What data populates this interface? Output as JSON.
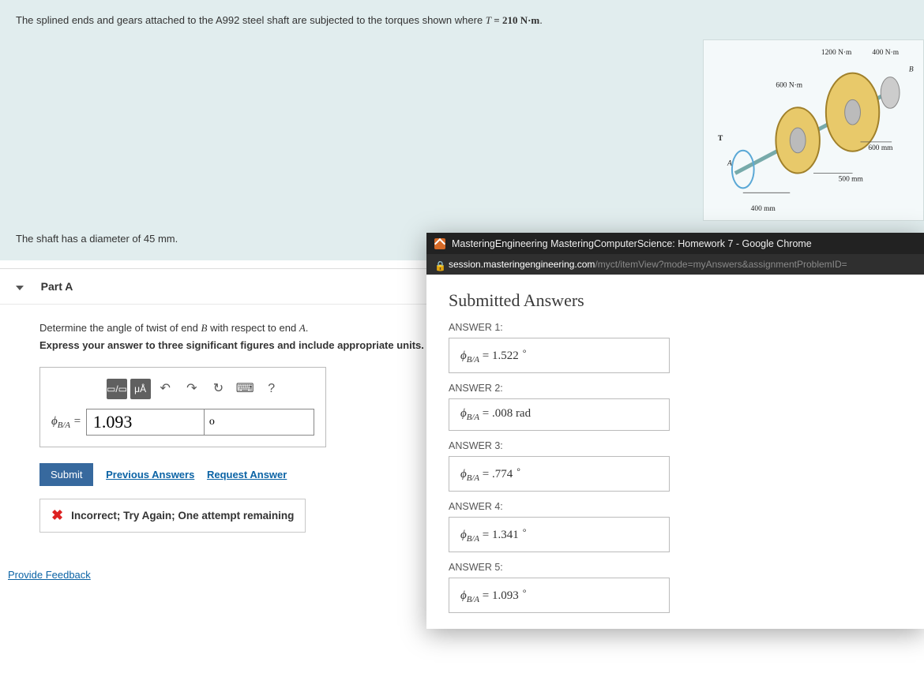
{
  "problem": {
    "intro_prefix": "The splined ends and gears attached to the A992 steel shaft are subjected to the torques shown where ",
    "torque_var": "T",
    "torque_eq": " = 210 N·m",
    "intro_suffix": ".",
    "diameter_line_prefix": "The shaft has a diameter of ",
    "diameter_value": "45 mm",
    "diameter_line_suffix": "."
  },
  "diagram": {
    "t1": "1200 N·m",
    "t2": "400 N·m",
    "t3": "600 N·m",
    "t_label": "T",
    "a_label": "A",
    "b_label": "B",
    "d1": "400 mm",
    "d2": "500 mm",
    "d3": "600 mm"
  },
  "part": {
    "title": "Part A",
    "instruction1_prefix": "Determine the angle of twist of end ",
    "instruction1_b": "B",
    "instruction1_mid": " with respect to end ",
    "instruction1_a": "A",
    "instruction1_suffix": ".",
    "instruction2": "Express your answer to three significant figures and include appropriate units.",
    "lhs_symbol": "ϕ",
    "lhs_sub": "B/A",
    "lhs_eq": " = ",
    "value_input": "1.093",
    "unit_input": "o",
    "toolbar": {
      "templates": "▭/▭",
      "units": "μÅ",
      "undo": "↶",
      "redo": "↷",
      "reset": "↻",
      "keyboard": "⌨",
      "help": "?"
    },
    "submit_label": "Submit",
    "prev_answers_label": "Previous Answers",
    "request_answer_label": "Request Answer",
    "feedback_msg": "Incorrect; Try Again; One attempt remaining"
  },
  "provide_feedback_label": "Provide Feedback",
  "popup": {
    "window_title": "MasteringEngineering MasteringComputerScience: Homework 7 - Google Chrome",
    "url_main": "session.masteringengineering.com",
    "url_rest": "/myct/itemView?mode=myAnswers&assignmentProblemID=",
    "heading": "Submitted Answers",
    "answers": [
      {
        "label": "ANSWER 1:",
        "value": "1.522",
        "unit_deg": true
      },
      {
        "label": "ANSWER 2:",
        "value": ".008 rad",
        "unit_deg": false
      },
      {
        "label": "ANSWER 3:",
        "value": ".774",
        "unit_deg": true
      },
      {
        "label": "ANSWER 4:",
        "value": "1.341",
        "unit_deg": true
      },
      {
        "label": "ANSWER 5:",
        "value": "1.093",
        "unit_deg": true
      }
    ]
  }
}
